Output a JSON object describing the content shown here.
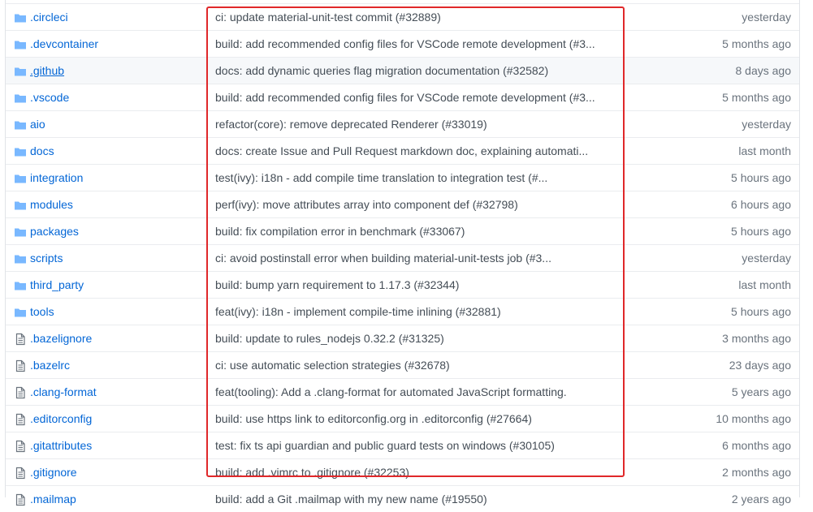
{
  "files": [
    {
      "kind": "folder",
      "name": ".circleci",
      "message": "ci: update material-unit-test commit (#32889)",
      "age": "yesterday"
    },
    {
      "kind": "folder",
      "name": ".devcontainer",
      "message": "build: add recommended config files for VSCode remote development (#3...",
      "age": "5 months ago"
    },
    {
      "kind": "folder",
      "name": ".github",
      "message": "docs: add dynamic queries flag migration documentation (#32582)",
      "age": "8 days ago"
    },
    {
      "kind": "folder",
      "name": ".vscode",
      "message": "build: add recommended config files for VSCode remote development (#3...",
      "age": "5 months ago"
    },
    {
      "kind": "folder",
      "name": "aio",
      "message": "refactor(core): remove deprecated Renderer (#33019)",
      "age": "yesterday"
    },
    {
      "kind": "folder",
      "name": "docs",
      "message": "docs: create Issue and Pull Request markdown doc, explaining automati...",
      "age": "last month"
    },
    {
      "kind": "folder",
      "name": "integration",
      "message": "test(ivy): i18n - add compile time translation to integration test (#...",
      "age": "5 hours ago"
    },
    {
      "kind": "folder",
      "name": "modules",
      "message": "perf(ivy): move attributes array into component def (#32798)",
      "age": "6 hours ago"
    },
    {
      "kind": "folder",
      "name": "packages",
      "message": "build: fix compilation error in benchmark (#33067)",
      "age": "5 hours ago"
    },
    {
      "kind": "folder",
      "name": "scripts",
      "message": "ci: avoid postinstall error when building material-unit-tests job (#3...",
      "age": "yesterday"
    },
    {
      "kind": "folder",
      "name": "third_party",
      "message": "build: bump yarn requirement to 1.17.3 (#32344)",
      "age": "last month"
    },
    {
      "kind": "folder",
      "name": "tools",
      "message": "feat(ivy): i18n - implement compile-time inlining (#32881)",
      "age": "5 hours ago"
    },
    {
      "kind": "file",
      "name": ".bazelignore",
      "message": "build: update to rules_nodejs 0.32.2 (#31325)",
      "age": "3 months ago"
    },
    {
      "kind": "file",
      "name": ".bazelrc",
      "message": "ci: use automatic selection strategies (#32678)",
      "age": "23 days ago"
    },
    {
      "kind": "file",
      "name": ".clang-format",
      "message": "feat(tooling): Add a .clang-format for automated JavaScript formatting.",
      "age": "5 years ago"
    },
    {
      "kind": "file",
      "name": ".editorconfig",
      "message": "build: use https link to editorconfig.org in .editorconfig (#27664)",
      "age": "10 months ago"
    },
    {
      "kind": "file",
      "name": ".gitattributes",
      "message": "test: fix ts api guardian and public guard tests on windows (#30105)",
      "age": "6 months ago"
    },
    {
      "kind": "file",
      "name": ".gitignore",
      "message": "build: add .vimrc to .gitignore (#32253)",
      "age": "2 months ago"
    },
    {
      "kind": "file",
      "name": ".mailmap",
      "message": "build: add a Git .mailmap with my new name (#19550)",
      "age": "2 years ago"
    }
  ],
  "hovered_row": ".github",
  "colors": {
    "link": "#0366d6",
    "folder_icon": "#79b8ff",
    "file_icon": "#6a737d",
    "highlight_box": "#e0282a",
    "hover_row": "#f6f8fa"
  }
}
